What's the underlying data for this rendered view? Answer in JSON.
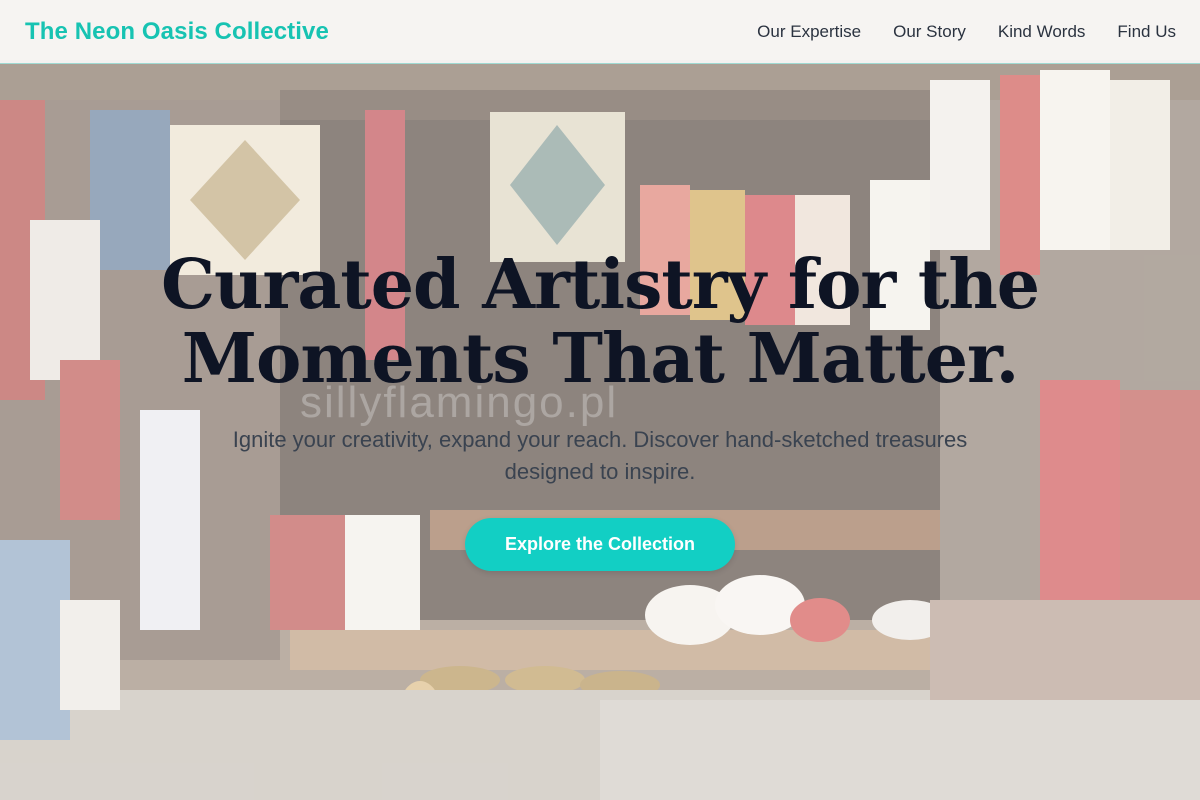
{
  "header": {
    "brand": "The Neon Oasis Collective",
    "nav": [
      {
        "label": "Our Expertise"
      },
      {
        "label": "Our Story"
      },
      {
        "label": "Kind Words"
      },
      {
        "label": "Find Us"
      }
    ]
  },
  "hero": {
    "headline": "Curated Artistry for the Moments That Matter.",
    "subtext": "Ignite your creativity, expand your reach. Discover hand-sketched treasures designed to inspire.",
    "cta_label": "Explore the Collection",
    "watermark": "sillyflamingo.pl"
  },
  "colors": {
    "brand": "#17c3b2",
    "cta_background": "#12cfc4",
    "headline": "#0e1424",
    "nav_text": "#2b3340"
  }
}
